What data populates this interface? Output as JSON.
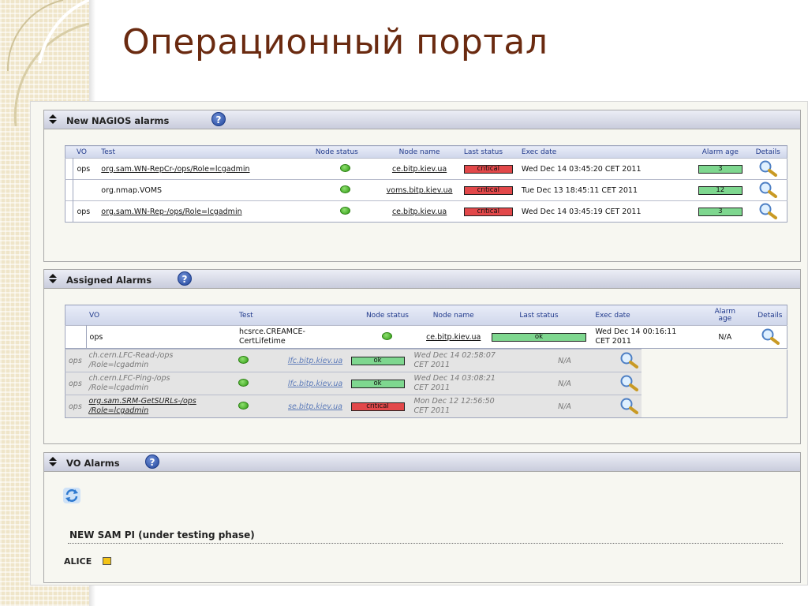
{
  "slide_title": "Операционный портал",
  "nagios": {
    "title": "New NAGIOS alarms",
    "help": "?",
    "headers": [
      "VO",
      "Test",
      "Node status",
      "Node name",
      "Last status",
      "Exec date",
      "Alarm age",
      "Details"
    ],
    "rows": [
      {
        "vo": "ops",
        "test": "org.sam.WN-RepCr-/ops/Role=lcgadmin",
        "node": "ce.bitp.kiev.ua",
        "status": "critical",
        "exec": "Wed Dec 14 03:45:20 CET 2011",
        "age": "3"
      },
      {
        "vo": "",
        "test": "org.nmap.VOMS",
        "node": "voms.bitp.kiev.ua",
        "status": "critical",
        "exec": "Tue Dec 13 18:45:11 CET 2011",
        "age": "12"
      },
      {
        "vo": "ops",
        "test": "org.sam.WN-Rep-/ops/Role=lcgadmin",
        "node": "ce.bitp.kiev.ua",
        "status": "critical",
        "exec": "Wed Dec 14 03:45:19 CET 2011",
        "age": "3"
      }
    ]
  },
  "assigned": {
    "title": "Assigned Alarms",
    "help": "?",
    "headers": [
      "VO",
      "Test",
      "Node status",
      "Node name",
      "Last status",
      "Exec date",
      "Alarm",
      "age",
      "Details"
    ],
    "row": {
      "vo": "ops",
      "test1": "hcsrce.CREAMCE-",
      "test2": "CertLifetime",
      "node": "ce.bitp.kiev.ua",
      "status": "ok",
      "exec1": "Wed Dec 14 00:16:11",
      "exec2": "CET 2011",
      "age": "N/A"
    },
    "grey_rows": [
      {
        "vo": "ops",
        "test1": "ch.cern.LFC-Read-/ops",
        "test2": "/Role=lcgadmin",
        "node": "lfc.bitp.kiev.ua",
        "status": "ok",
        "exec1": "Wed Dec 14 02:58:07",
        "exec2": "CET 2011",
        "age": "N/A"
      },
      {
        "vo": "ops",
        "test1": "ch.cern.LFC-Ping-/ops",
        "test2": "/Role=lcgadmin",
        "node": "lfc.bitp.kiev.ua",
        "status": "ok",
        "exec1": "Wed Dec 14 03:08:21",
        "exec2": "CET 2011",
        "age": "N/A"
      },
      {
        "vo": "ops",
        "test1": "org.sam.SRM-GetSURLs-/ops",
        "test2": "/Role=lcgadmin",
        "node": "se.bitp.kiev.ua",
        "status": "critical",
        "exec1": "Mon Dec 12 12:56:50",
        "exec2": "CET 2011",
        "age": "N/A"
      }
    ]
  },
  "vo_alarms": {
    "title": "VO Alarms",
    "help": "?",
    "sam_pi": "NEW SAM PI (under testing phase)",
    "alice": "ALICE"
  },
  "colors": {
    "critical": "#e2484a",
    "ok": "#7ed78f",
    "title": "#6a2a10",
    "header_text": "#213a8c"
  }
}
